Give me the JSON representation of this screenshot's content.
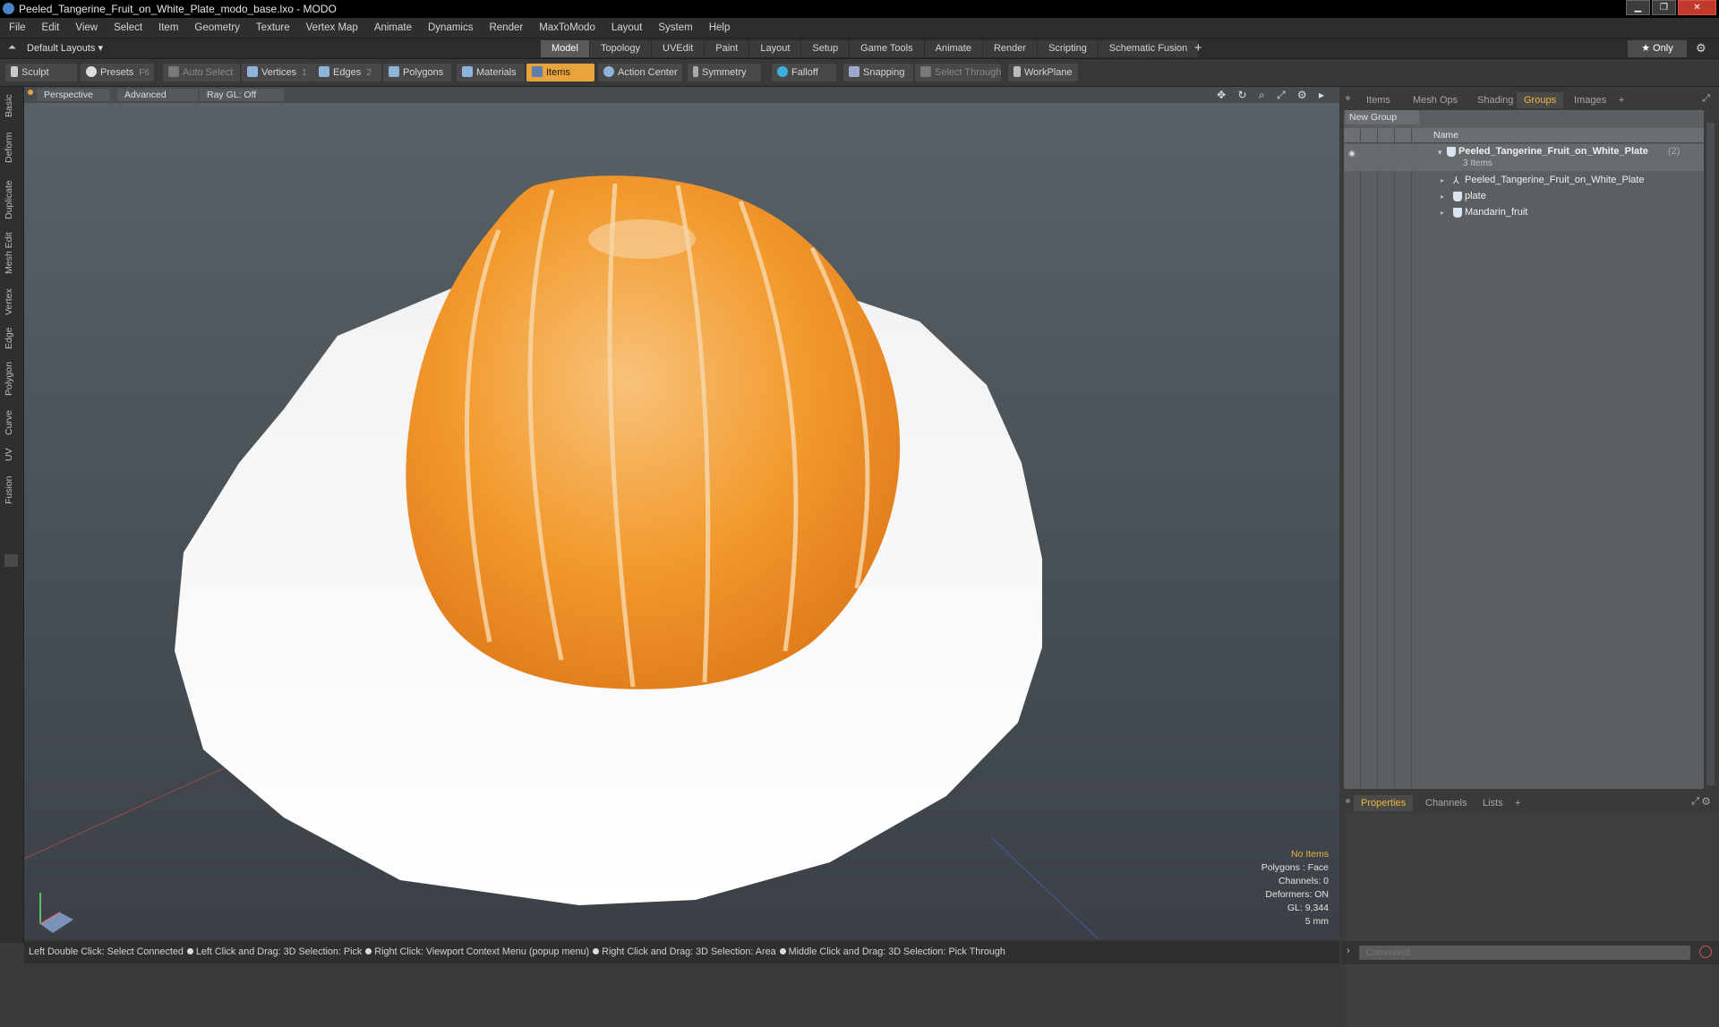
{
  "window": {
    "title": "Peeled_Tangerine_Fruit_on_White_Plate_modo_base.lxo - MODO"
  },
  "menu": [
    "File",
    "Edit",
    "View",
    "Select",
    "Item",
    "Geometry",
    "Texture",
    "Vertex Map",
    "Animate",
    "Dynamics",
    "Render",
    "MaxToModo",
    "Layout",
    "System",
    "Help"
  ],
  "layout_bar": {
    "layouts_label": "Default Layouts ▾",
    "tabs": [
      "Model",
      "Topology",
      "UVEdit",
      "Paint",
      "Layout",
      "Setup",
      "Game Tools",
      "Animate",
      "Render",
      "Scripting",
      "Schematic Fusion"
    ],
    "active_tab": "Model",
    "plus": "+",
    "only_label": "★ Only"
  },
  "toolbar": {
    "sculpt": "Sculpt",
    "presets": "Presets",
    "presets_key": "F6",
    "auto_select": "Auto Select",
    "vertices": "Vertices",
    "vertices_count": "1",
    "edges": "Edges",
    "edges_count": "2",
    "polygons": "Polygons",
    "materials": "Materials",
    "items": "Items",
    "action_center": "Action Center",
    "symmetry": "Symmetry",
    "falloff": "Falloff",
    "snapping": "Snapping",
    "select_through": "Select Through",
    "workplane": "WorkPlane"
  },
  "left_tabs": [
    "Basic",
    "Deform",
    "Duplicate",
    "Mesh Edit",
    "Vertex",
    "Edge",
    "Polygon",
    "Curve",
    "UV",
    "Fusion"
  ],
  "viewport": {
    "perspective": "Perspective",
    "advanced": "Advanced",
    "raygl": "Ray GL: Off",
    "icons": "✥ ↻ ⌕ ⤢ ⚙ ▸",
    "hud": {
      "no_items": "No Items",
      "polygons": "Polygons : Face",
      "channels": "Channels: 0",
      "deformers": "Deformers: ON",
      "gl": "GL: 9,344",
      "scale": "5 mm"
    },
    "colors": {
      "plate": "#ffffff",
      "fruit": "#f29a2e",
      "fruit_light": "#f7d6a6"
    }
  },
  "statusbar": {
    "hints": [
      "Left Double Click: Select Connected",
      "Left Click and Drag: 3D Selection: Pick",
      "Right Click: Viewport Context Menu (popup menu)",
      "Right Click and Drag: 3D Selection: Area",
      "Middle Click and Drag: 3D Selection: Pick Through"
    ]
  },
  "right_panel": {
    "tabs": [
      "Items",
      "Mesh Ops",
      "Shading",
      "Groups",
      "Images",
      "+"
    ],
    "active_tab": "Groups",
    "new_group": "New Group",
    "column_name": "Name",
    "group": {
      "name": "Peeled_Tangerine_Fruit_on_White_Plate",
      "count": "(2)",
      "subtitle": "3 Items",
      "children": [
        "Peeled_Tangerine_Fruit_on_White_Plate",
        "plate",
        "Mandarin_fruit"
      ]
    },
    "bottom_tabs": [
      "Properties",
      "Channels",
      "Lists",
      "+"
    ],
    "bottom_active": "Properties",
    "command_placeholder": "Command"
  }
}
